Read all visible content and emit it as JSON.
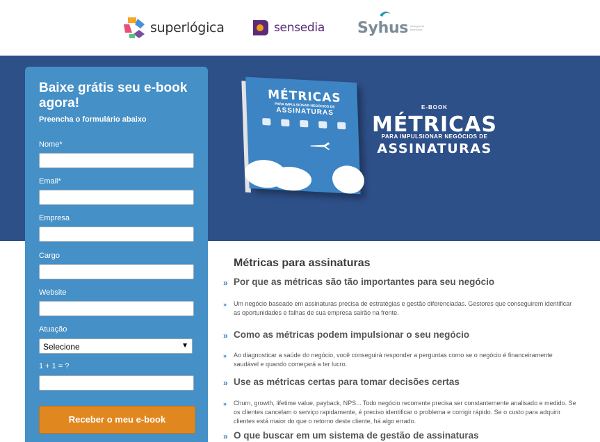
{
  "logos": {
    "superlogica": "superlógica",
    "sensedia": "sensedia",
    "syhus": "Syhus",
    "syhus_tagline": "inteligência financeira"
  },
  "ebook": {
    "label": "E-BOOK",
    "title": "MÉTRICAS",
    "subtitle": "PARA IMPULSIONAR NEGÓCIOS DE",
    "title2": "ASSINATURAS"
  },
  "book_cover": {
    "title": "MÉTRICAS",
    "subtitle": "PARA IMPULSIONAR NEGÓCIOS DE",
    "title2": "ASSINATURAS"
  },
  "form": {
    "heading": "Baixe grátis seu e-book agora!",
    "subheading": "Preencha o formulário abaixo",
    "fields": {
      "nome": {
        "label": "Nome*",
        "value": ""
      },
      "email": {
        "label": "Email*",
        "value": ""
      },
      "empresa": {
        "label": "Empresa",
        "value": ""
      },
      "cargo": {
        "label": "Cargo",
        "value": ""
      },
      "website": {
        "label": "Website",
        "value": ""
      },
      "atuacao": {
        "label": "Atuação",
        "selected": "Selecione"
      },
      "captcha": {
        "label": "1 + 1 = ?",
        "value": ""
      }
    },
    "submit": "Receber o meu e-book"
  },
  "content": {
    "title": "Métricas para assinaturas",
    "chevron": "»",
    "sections": [
      {
        "heading": "Por que as métricas são tão importantes para seu negócio",
        "text": "Um negócio baseado em assinaturas precisa de estratégias e gestão diferenciadas. Gestores que conseguirem identificar as oportunidades e falhas de sua empresa sairão na frente."
      },
      {
        "heading": "Como as métricas podem impulsionar o seu negócio",
        "text": "Ao diagnosticar a saúde do negócio, você conseguirá responder a perguntas como se o negócio é financeiramente saudável e quando começará a ter lucro."
      },
      {
        "heading": "Use as métricas certas para tomar decisões certas",
        "text": "Churn, growth, lifetime value, payback, NPS... Todo negócio recorrente precisa ser constantemente analisado e medido. Se os clientes cancelam o serviço rapidamente, é preciso identificar o problema e corrigir rápido. Se o custo para adquirir clientes está maior do que o retorno deste cliente, há algo errado."
      },
      {
        "heading": "O que buscar em um sistema de gestão de assinaturas"
      }
    ]
  },
  "colors": {
    "hero_bg": "#2e5089",
    "form_bg": "#4590c6",
    "button_bg": "#e1871f",
    "chevron": "#3d7fc0"
  }
}
